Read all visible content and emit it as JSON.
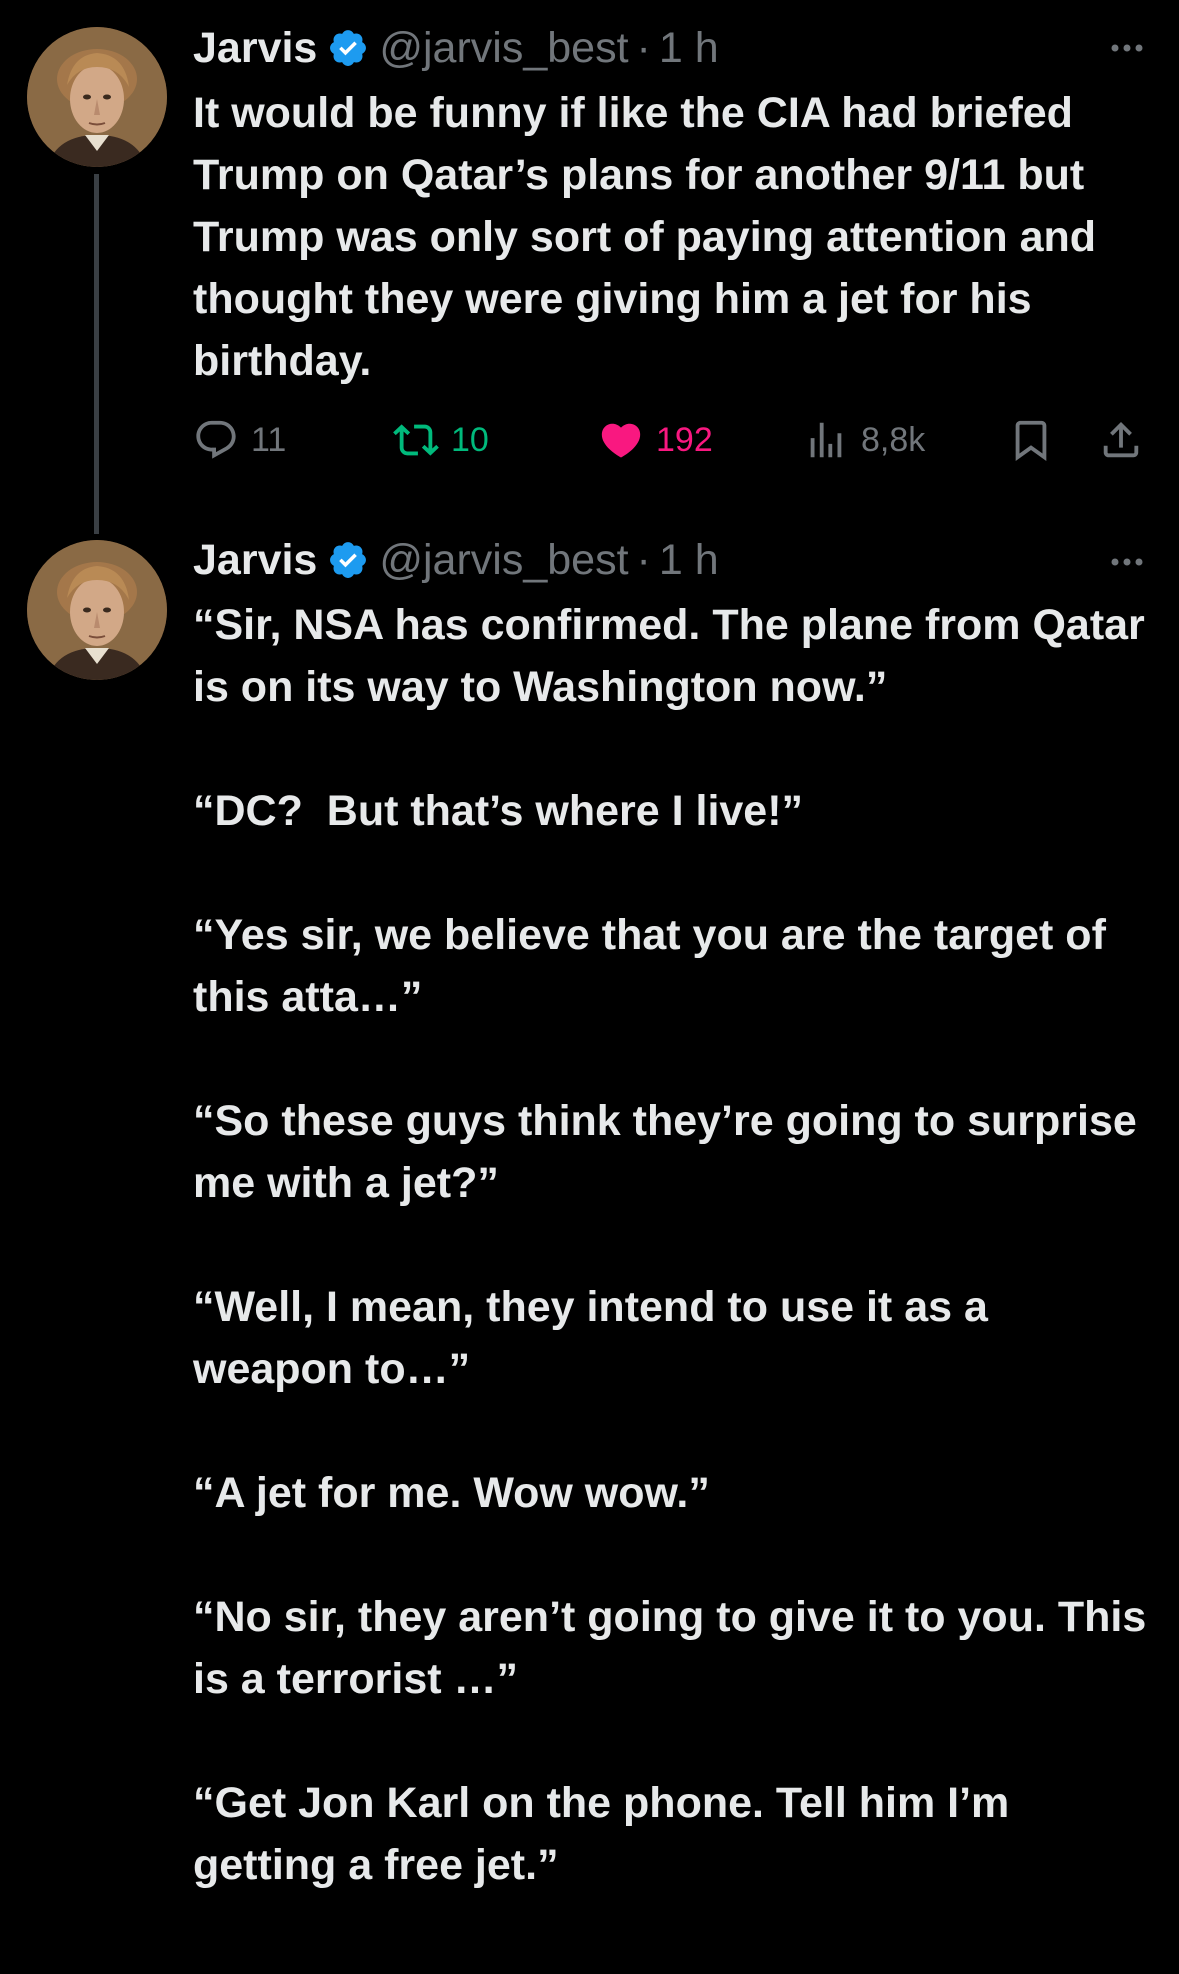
{
  "tweets": [
    {
      "author_name": "Jarvis",
      "handle": "@jarvis_best",
      "separator": "·",
      "time": "1 h",
      "text": "It would be funny if like the CIA had briefed Trump on Qatar’s plans for another 9/11 but Trump was only sort of paying attention and thought they were giving him a jet for his birthday.",
      "replies": "11",
      "retweets": "10",
      "likes": "192",
      "views": "8,8k",
      "liked": true
    },
    {
      "author_name": "Jarvis",
      "handle": "@jarvis_best",
      "separator": "·",
      "time": "1 h",
      "text": "“Sir, NSA has confirmed. The plane from Qatar is on its way to Washington now.”\n\n“DC?  But that’s where I live!”\n\n“Yes sir, we believe that you are the target of this atta…”\n\n“So these guys think they’re going to surprise me with a jet?”\n\n“Well, I mean, they intend to use it as a weapon to…”\n\n“A jet for me. Wow wow.”\n\n“No sir, they aren’t going to give it to you. This is a terrorist …”\n\n“Get Jon Karl on the phone. Tell him I’m getting a free jet.”"
    }
  ],
  "colors": {
    "background": "#000000",
    "text": "#e7e9ea",
    "muted": "#71767b",
    "verified": "#1d9bf0",
    "retweet": "#00ba7c",
    "like": "#f91880",
    "thread_line": "#3a3f44"
  },
  "icons": {
    "verified": "verified-badge-icon",
    "more": "more-horizontal-icon",
    "reply": "reply-icon",
    "retweet": "retweet-icon",
    "like": "heart-icon",
    "views": "views-icon",
    "bookmark": "bookmark-icon",
    "share": "share-icon"
  }
}
